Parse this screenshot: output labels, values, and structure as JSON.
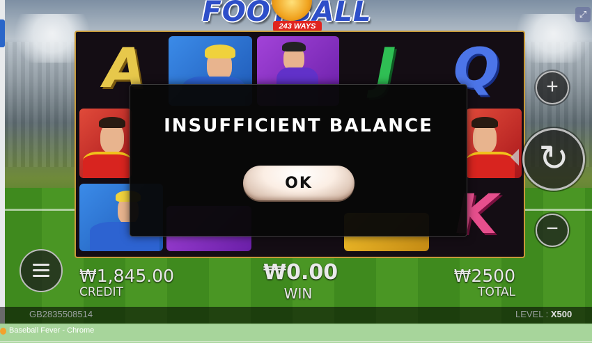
{
  "game": {
    "title": "FOOTBALL FEVER",
    "ways_badge": "243 WAYS"
  },
  "reels": {
    "symbols": [
      "A",
      "J",
      "Q",
      "K"
    ]
  },
  "modal": {
    "message": "INSUFFICIENT BALANCE",
    "ok_label": "OK"
  },
  "stats": {
    "credit_value": "₩1,845.00",
    "credit_label": "CREDIT",
    "win_value": "₩0.00",
    "win_label": "WIN",
    "total_value": "₩2500",
    "total_label": "TOTAL"
  },
  "footer": {
    "game_id": "GB2835508514",
    "level_label": "LEVEL :",
    "level_value": "X500"
  },
  "controls": {
    "plus_icon": "+",
    "minus_icon": "−",
    "spin_icon": "↻",
    "fullscreen_icon": "⤢"
  },
  "taskbar": {
    "window_title": "Baseball Fever - Chrome"
  }
}
